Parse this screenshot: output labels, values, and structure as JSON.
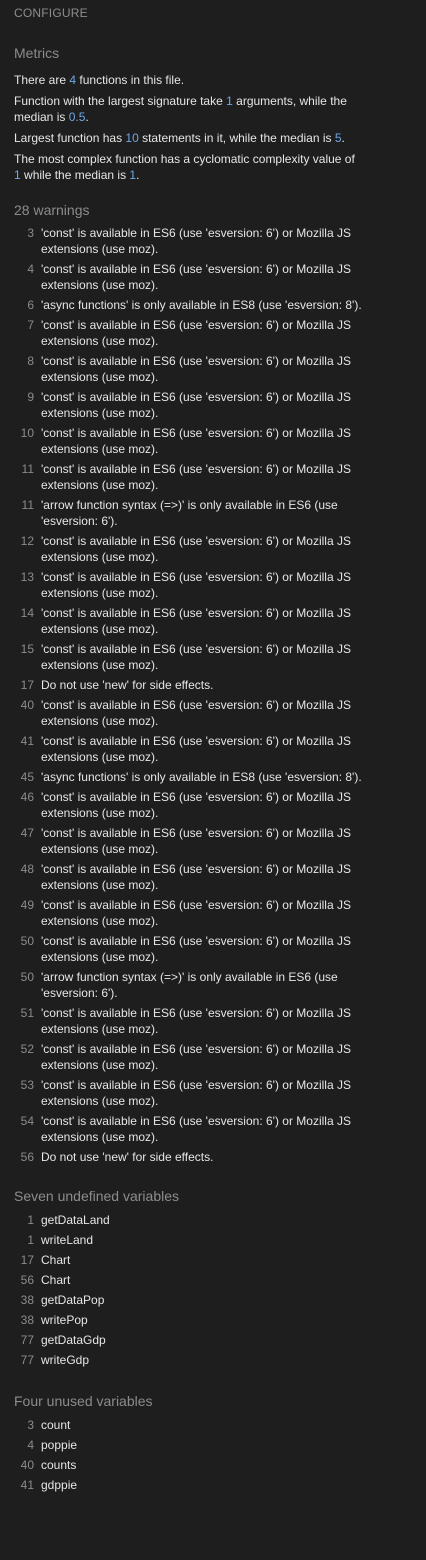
{
  "header": {
    "configure_label": "CONFIGURE"
  },
  "metrics": {
    "title": "Metrics",
    "line1": {
      "pre": "There are ",
      "n": "4",
      "post": " functions in this file."
    },
    "line2": {
      "pre": "Function with the largest signature take ",
      "n1": "1",
      "mid": " arguments, while the median is ",
      "n2": "0.5",
      "post": "."
    },
    "line3": {
      "pre": "Largest function has ",
      "n1": "10",
      "mid": " statements in it, while the median is ",
      "n2": "5",
      "post": "."
    },
    "line4": {
      "pre": "The most complex function has a cyclomatic complexity value of ",
      "n1": "1",
      "mid": " while the median is ",
      "n2": "1",
      "post": "."
    }
  },
  "warnings": {
    "title": "28 warnings",
    "items": [
      {
        "line": "3",
        "msg": "'const' is available in ES6 (use 'esversion: 6') or Mozilla JS extensions (use moz)."
      },
      {
        "line": "4",
        "msg": "'const' is available in ES6 (use 'esversion: 6') or Mozilla JS extensions (use moz)."
      },
      {
        "line": "6",
        "msg": "'async functions' is only available in ES8 (use 'esversion: 8')."
      },
      {
        "line": "7",
        "msg": "'const' is available in ES6 (use 'esversion: 6') or Mozilla JS extensions (use moz)."
      },
      {
        "line": "8",
        "msg": "'const' is available in ES6 (use 'esversion: 6') or Mozilla JS extensions (use moz)."
      },
      {
        "line": "9",
        "msg": "'const' is available in ES6 (use 'esversion: 6') or Mozilla JS extensions (use moz)."
      },
      {
        "line": "10",
        "msg": "'const' is available in ES6 (use 'esversion: 6') or Mozilla JS extensions (use moz)."
      },
      {
        "line": "11",
        "msg": "'const' is available in ES6 (use 'esversion: 6') or Mozilla JS extensions (use moz)."
      },
      {
        "line": "11",
        "msg": "'arrow function syntax (=>)' is only available in ES6 (use 'esversion: 6')."
      },
      {
        "line": "12",
        "msg": "'const' is available in ES6 (use 'esversion: 6') or Mozilla JS extensions (use moz)."
      },
      {
        "line": "13",
        "msg": "'const' is available in ES6 (use 'esversion: 6') or Mozilla JS extensions (use moz)."
      },
      {
        "line": "14",
        "msg": "'const' is available in ES6 (use 'esversion: 6') or Mozilla JS extensions (use moz)."
      },
      {
        "line": "15",
        "msg": "'const' is available in ES6 (use 'esversion: 6') or Mozilla JS extensions (use moz)."
      },
      {
        "line": "17",
        "msg": "Do not use 'new' for side effects."
      },
      {
        "line": "40",
        "msg": "'const' is available in ES6 (use 'esversion: 6') or Mozilla JS extensions (use moz)."
      },
      {
        "line": "41",
        "msg": "'const' is available in ES6 (use 'esversion: 6') or Mozilla JS extensions (use moz)."
      },
      {
        "line": "45",
        "msg": "'async functions' is only available in ES8 (use 'esversion: 8')."
      },
      {
        "line": "46",
        "msg": "'const' is available in ES6 (use 'esversion: 6') or Mozilla JS extensions (use moz)."
      },
      {
        "line": "47",
        "msg": "'const' is available in ES6 (use 'esversion: 6') or Mozilla JS extensions (use moz)."
      },
      {
        "line": "48",
        "msg": "'const' is available in ES6 (use 'esversion: 6') or Mozilla JS extensions (use moz)."
      },
      {
        "line": "49",
        "msg": "'const' is available in ES6 (use 'esversion: 6') or Mozilla JS extensions (use moz)."
      },
      {
        "line": "50",
        "msg": "'const' is available in ES6 (use 'esversion: 6') or Mozilla JS extensions (use moz)."
      },
      {
        "line": "50",
        "msg": "'arrow function syntax (=>)' is only available in ES6 (use 'esversion: 6')."
      },
      {
        "line": "51",
        "msg": "'const' is available in ES6 (use 'esversion: 6') or Mozilla JS extensions (use moz)."
      },
      {
        "line": "52",
        "msg": "'const' is available in ES6 (use 'esversion: 6') or Mozilla JS extensions (use moz)."
      },
      {
        "line": "53",
        "msg": "'const' is available in ES6 (use 'esversion: 6') or Mozilla JS extensions (use moz)."
      },
      {
        "line": "54",
        "msg": "'const' is available in ES6 (use 'esversion: 6') or Mozilla JS extensions (use moz)."
      },
      {
        "line": "56",
        "msg": "Do not use 'new' for side effects."
      }
    ]
  },
  "undefined_vars": {
    "title": "Seven undefined variables",
    "items": [
      {
        "line": "1",
        "name": "getDataLand"
      },
      {
        "line": "1",
        "name": "writeLand"
      },
      {
        "line": "17",
        "name": "Chart"
      },
      {
        "line": "56",
        "name": "Chart"
      },
      {
        "line": "38",
        "name": "getDataPop"
      },
      {
        "line": "38",
        "name": "writePop"
      },
      {
        "line": "77",
        "name": "getDataGdp"
      },
      {
        "line": "77",
        "name": "writeGdp"
      }
    ]
  },
  "unused_vars": {
    "title": "Four unused variables",
    "items": [
      {
        "line": "3",
        "name": "count"
      },
      {
        "line": "4",
        "name": "poppie"
      },
      {
        "line": "40",
        "name": "counts"
      },
      {
        "line": "41",
        "name": "gdppie"
      }
    ]
  },
  "colors": {
    "background": "#1e1e1e",
    "text": "#e6e6e6",
    "muted": "#8c8c8c",
    "number": "#6ea8e6"
  }
}
